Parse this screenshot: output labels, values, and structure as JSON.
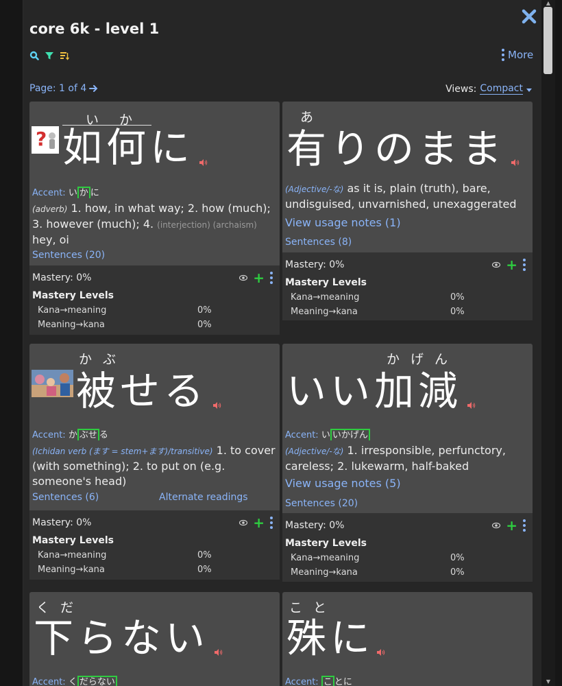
{
  "header": {
    "title": "core 6k - level 1",
    "more_label": "More",
    "page_label": "Page: 1 of 4",
    "views_label": "Views:",
    "views_value": "Compact"
  },
  "cards": [
    {
      "reading": "いか",
      "word": "如何に",
      "accent_label": "Accent:",
      "accent_pre": "い",
      "accent_box": "か",
      "accent_post": "に",
      "pos": "(adverb)",
      "meaning_a": " 1. how, in what way; 2. how (much); 3. however (much); 4. ",
      "pos_extra": "(interjection) (archaism)",
      "meaning_b": " hey, oi",
      "sentences": "Sentences (20)",
      "mastery": "Mastery: 0%",
      "mastery_levels": "Mastery Levels",
      "kana_meaning": "Kana→meaning",
      "kana_meaning_val": "0%",
      "meaning_kana": "Meaning→kana",
      "meaning_kana_val": "0%"
    },
    {
      "reading": "あ",
      "word": "有りのまま",
      "pos": "(Adjective/-な)",
      "meaning_a": " as it is, plain (truth), bare, undisguised, unvarnished, unexaggerated",
      "usage": "View usage notes (1)",
      "sentences": "Sentences (8)",
      "mastery": "Mastery: 0%",
      "mastery_levels": "Mastery Levels",
      "kana_meaning": "Kana→meaning",
      "kana_meaning_val": "0%",
      "meaning_kana": "Meaning→kana",
      "meaning_kana_val": "0%"
    },
    {
      "reading": "かぶ",
      "word": "被せる",
      "accent_label": "Accent:",
      "accent_pre": "か",
      "accent_box": "ぶせ",
      "accent_post": "る",
      "pos": "(Ichidan verb (ます = stem+ます)/transitive)",
      "meaning_a": " 1. to cover (with something); 2. to put on (e.g. someone's head)",
      "sentences": "Sentences (6)",
      "alt": "Alternate readings",
      "mastery": "Mastery: 0%",
      "mastery_levels": "Mastery Levels",
      "kana_meaning": "Kana→meaning",
      "kana_meaning_val": "0%",
      "meaning_kana": "Meaning→kana",
      "meaning_kana_val": "0%"
    },
    {
      "reading": "かげん",
      "word": "いい加減",
      "accent_label": "Accent:",
      "accent_pre": "い",
      "accent_box": "いかげん",
      "accent_post": "",
      "pos": "(Adjective/-な)",
      "meaning_a": " 1. irresponsible, perfunctory, careless; 2. lukewarm, half-baked",
      "usage": "View usage notes (5)",
      "sentences": "Sentences (20)",
      "mastery": "Mastery: 0%",
      "mastery_levels": "Mastery Levels",
      "kana_meaning": "Kana→meaning",
      "kana_meaning_val": "0%",
      "meaning_kana": "Meaning→kana",
      "meaning_kana_val": "0%"
    },
    {
      "reading": "くだ",
      "word": "下らない",
      "accent_label": "Accent:",
      "accent_pre": "く",
      "accent_box": "だらない",
      "accent_post": ""
    },
    {
      "reading": "こと",
      "word": "殊に",
      "accent_label": "Accent:",
      "accent_pre": "",
      "accent_box": "こ",
      "accent_post": "とに"
    }
  ]
}
